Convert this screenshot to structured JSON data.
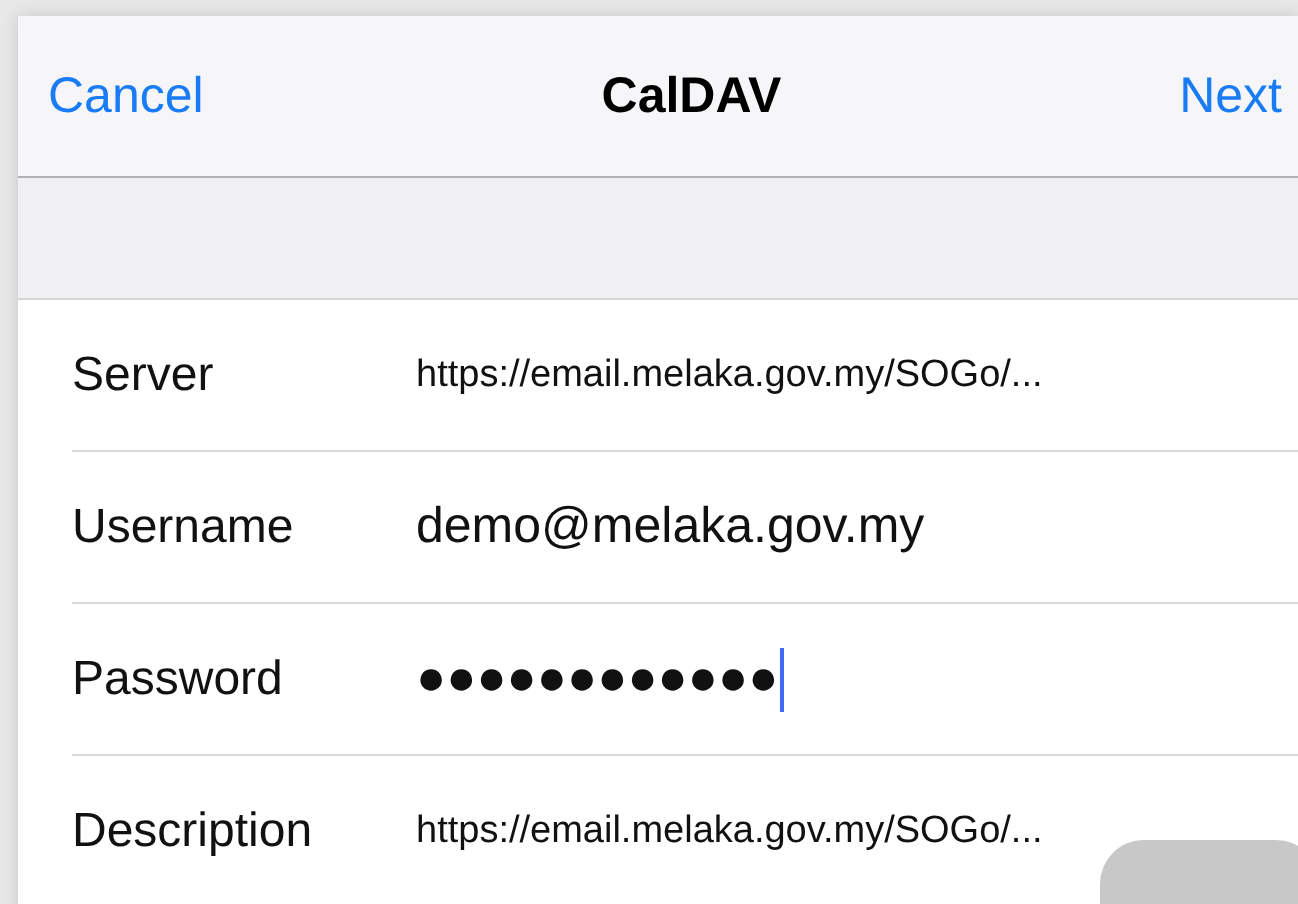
{
  "nav_bar": {
    "cancel": "Cancel",
    "title": "CalDAV",
    "next": "Next"
  },
  "fields": [
    {
      "kind": "url",
      "label": "Server",
      "value": "https://email.melaka.gov.my/SOGo/...",
      "focused": false
    },
    {
      "kind": "email",
      "label": "Username",
      "value": "demo@melaka.gov.my",
      "focused": false
    },
    {
      "kind": "password",
      "label": "Password",
      "value": "●●●●●●●●●●●●",
      "focused": true
    },
    {
      "kind": "url",
      "label": "Description",
      "value": "https://email.melaka.gov.my/SOGo/...",
      "focused": false
    }
  ]
}
